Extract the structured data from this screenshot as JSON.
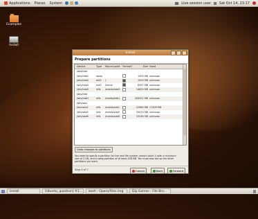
{
  "panel": {
    "menus": [
      "Applications",
      "Places",
      "System"
    ],
    "tray_text": "Live session user",
    "clock": "Sat Oct 14, 23:17",
    "colors": {
      "applications_icon": "#d24a2a",
      "places_icon": "#5577aa",
      "system_icon": "#557799"
    }
  },
  "desktop": {
    "icons": [
      {
        "label": "Examples",
        "icon": "folder-icon"
      },
      {
        "label": "Install",
        "icon": "drive-icon"
      }
    ]
  },
  "taskbar": {
    "items": [
      "Install",
      "[Ubuntu_question] #1...",
      "bash - Opera/Files.img",
      "Dip Games - File Bro..."
    ]
  },
  "dialog": {
    "window_title": "Install",
    "heading": "Prepare partitions",
    "columns": [
      "Device",
      "Type",
      "Mount point",
      "Format?",
      "Size",
      "Used"
    ],
    "rows": [
      {
        "kind": "disk",
        "device": "/dev/hda",
        "type": "",
        "mount": "",
        "format": false,
        "size": "",
        "used": ""
      },
      {
        "kind": "part",
        "device": "/dev/hda1",
        "type": "swap",
        "mount": "",
        "format": false,
        "size": "1003 MB",
        "used": "unknown"
      },
      {
        "kind": "part",
        "device": "/dev/hda2",
        "type": "ext3",
        "mount": "/",
        "format": true,
        "size": "1003 MB",
        "used": "unknown"
      },
      {
        "kind": "part",
        "device": "/dev/hda3",
        "type": "ext3",
        "mount": "/home",
        "format": true,
        "size": "8597 MB",
        "used": "unknown"
      },
      {
        "kind": "part",
        "device": "/dev/hda5",
        "type": "ntfs",
        "mount": "/media/hda5",
        "format": false,
        "size": "14629 MB",
        "used": "unknown"
      },
      {
        "kind": "disk",
        "device": "/dev/hdb",
        "type": "",
        "mount": "",
        "format": false,
        "size": "",
        "used": ""
      },
      {
        "kind": "part",
        "device": "/dev/hdb1",
        "type": "ntfs",
        "mount": "/media/hdb1",
        "format": false,
        "size": "163921 MB",
        "used": "unknown"
      },
      {
        "kind": "disk",
        "device": "/dev/sda",
        "type": "",
        "mount": "",
        "format": false,
        "size": "",
        "used": ""
      },
      {
        "kind": "part",
        "device": "/dev/sda1",
        "type": "ntfs",
        "mount": "/media/sda1",
        "format": false,
        "size": "22660 MB",
        "used": "17499 MB"
      },
      {
        "kind": "part",
        "device": "/dev/sda5",
        "type": "ntfs",
        "mount": "/media/sda5",
        "format": false,
        "size": "29473 MB",
        "used": "unknown"
      },
      {
        "kind": "part",
        "device": "/dev/sda6",
        "type": "ntfs",
        "mount": "/media/sda6",
        "format": false,
        "size": "33146 MB",
        "used": "unknown"
      }
    ],
    "undo_label": "Undo changes to partitions",
    "message": "You need to specify a partition for the root file system (mount point /) with a minimum size of 2 GB, and a swap partition of at least 256 MB. You must also set up the other partitions you want.",
    "step_label": "Step 4 of 7",
    "buttons": {
      "cancel": "Cancel",
      "back": "Back",
      "forward": "Forward"
    },
    "colors": {
      "titlebar": "#c58a4f",
      "cancel_icon": "#c0392b",
      "back_icon": "#3a8f3a",
      "forward_icon": "#3a8f3a"
    }
  }
}
